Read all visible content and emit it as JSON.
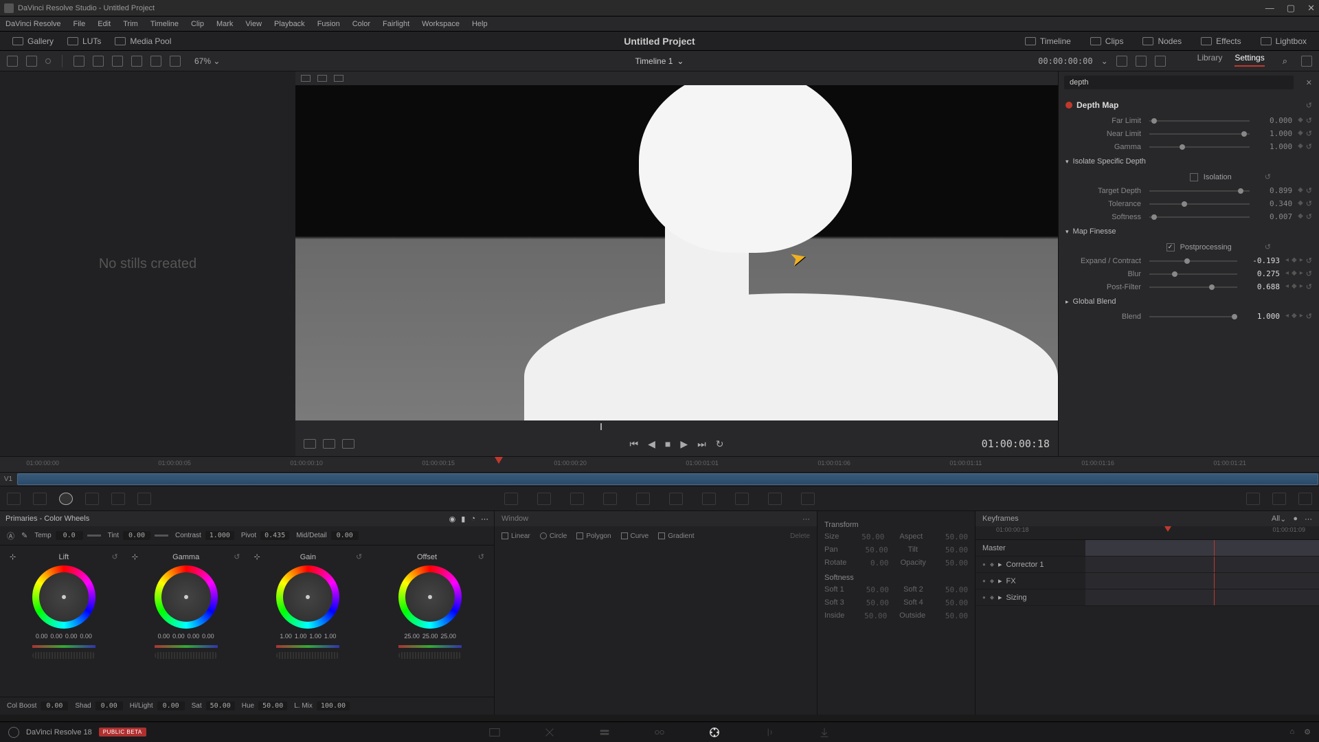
{
  "titlebar": {
    "text": "DaVinci Resolve Studio - Untitled Project"
  },
  "menu": [
    "DaVinci Resolve",
    "File",
    "Edit",
    "Trim",
    "Timeline",
    "Clip",
    "Mark",
    "View",
    "Playback",
    "Fusion",
    "Color",
    "Fairlight",
    "Workspace",
    "Help"
  ],
  "top_toolbar": {
    "left": [
      {
        "label": "Gallery",
        "icon": "gallery-icon"
      },
      {
        "label": "LUTs",
        "icon": "luts-icon"
      },
      {
        "label": "Media Pool",
        "icon": "mediapool-icon"
      }
    ],
    "project": "Untitled Project",
    "right": [
      {
        "label": "Timeline",
        "icon": "timeline-icon"
      },
      {
        "label": "Clips",
        "icon": "clips-icon"
      },
      {
        "label": "Nodes",
        "icon": "nodes-icon"
      },
      {
        "label": "Effects",
        "icon": "effects-icon"
      },
      {
        "label": "Lightbox",
        "icon": "lightbox-icon"
      }
    ]
  },
  "secondary": {
    "zoom": "67%",
    "timeline_name": "Timeline 1",
    "timecode": "00:00:00:00",
    "tabs": {
      "library": "Library",
      "settings": "Settings"
    }
  },
  "gallery_empty": "No stills created",
  "transport_tc": "01:00:00:18",
  "inspector": {
    "search": "depth",
    "effect": "Depth Map",
    "params": {
      "far_limit": {
        "label": "Far Limit",
        "value": "0.000"
      },
      "near_limit": {
        "label": "Near Limit",
        "value": "1.000"
      },
      "gamma": {
        "label": "Gamma",
        "value": "1.000"
      }
    },
    "isolate": {
      "header": "Isolate Specific Depth",
      "isolation_label": "Isolation",
      "target_depth": {
        "label": "Target Depth",
        "value": "0.899"
      },
      "tolerance": {
        "label": "Tolerance",
        "value": "0.340"
      },
      "softness": {
        "label": "Softness",
        "value": "0.007"
      }
    },
    "finesse": {
      "header": "Map Finesse",
      "postprocessing_label": "Postprocessing",
      "postprocessing_checked": true,
      "expand": {
        "label": "Expand / Contract",
        "value": "-0.193"
      },
      "blur": {
        "label": "Blur",
        "value": "0.275"
      },
      "postfilter": {
        "label": "Post-Filter",
        "value": "0.688"
      }
    },
    "global_blend": {
      "header": "Global Blend",
      "blend": {
        "label": "Blend",
        "value": "1.000"
      }
    }
  },
  "ruler_ticks": [
    "01:00:00:00",
    "01:00:00:05",
    "01:00:00:10",
    "01:00:00:15",
    "01:00:00:20",
    "01:00:01:01",
    "01:00:01:06",
    "01:00:01:11",
    "01:00:01:16",
    "01:00:01:21"
  ],
  "track_label": "V1",
  "primaries": {
    "title": "Primaries - Color Wheels",
    "adjust": {
      "temp": {
        "label": "Temp",
        "value": "0.0"
      },
      "tint": {
        "label": "Tint",
        "value": "0.00"
      },
      "contrast": {
        "label": "Contrast",
        "value": "1.000"
      },
      "pivot": {
        "label": "Pivot",
        "value": "0.435"
      },
      "middetail": {
        "label": "Mid/Detail",
        "value": "0.00"
      }
    },
    "wheels": [
      {
        "name": "Lift",
        "vals": [
          "0.00",
          "0.00",
          "0.00",
          "0.00"
        ]
      },
      {
        "name": "Gamma",
        "vals": [
          "0.00",
          "0.00",
          "0.00",
          "0.00"
        ]
      },
      {
        "name": "Gain",
        "vals": [
          "1.00",
          "1.00",
          "1.00",
          "1.00"
        ]
      },
      {
        "name": "Offset",
        "vals": [
          "25.00",
          "25.00",
          "25.00"
        ]
      }
    ],
    "footer": {
      "colboost": {
        "label": "Col Boost",
        "value": "0.00"
      },
      "shad": {
        "label": "Shad",
        "value": "0.00"
      },
      "hilight": {
        "label": "Hi/Light",
        "value": "0.00"
      },
      "sat": {
        "label": "Sat",
        "value": "50.00"
      },
      "hue": {
        "label": "Hue",
        "value": "50.00"
      },
      "lmix": {
        "label": "L. Mix",
        "value": "100.00"
      }
    }
  },
  "window_panel": {
    "title": "Window",
    "tools": [
      "Linear",
      "Circle",
      "Polygon",
      "Curve",
      "Gradient"
    ],
    "delete": "Delete"
  },
  "transform": {
    "title": "Transform",
    "size": {
      "label": "Size",
      "value": "50.00"
    },
    "aspect": {
      "label": "Aspect",
      "value": "50.00"
    },
    "pan": {
      "label": "Pan",
      "value": "50.00"
    },
    "tilt": {
      "label": "Tilt",
      "value": "50.00"
    },
    "rotate": {
      "label": "Rotate",
      "value": "0.00"
    },
    "opacity": {
      "label": "Opacity",
      "value": "50.00"
    },
    "softness_header": "Softness",
    "soft1": {
      "label": "Soft 1",
      "value": "50.00"
    },
    "soft2": {
      "label": "Soft 2",
      "value": "50.00"
    },
    "soft3": {
      "label": "Soft 3",
      "value": "50.00"
    },
    "soft4": {
      "label": "Soft 4",
      "value": "50.00"
    },
    "inside": {
      "label": "Inside",
      "value": "50.00"
    },
    "outside": {
      "label": "Outside",
      "value": "50.00"
    }
  },
  "keyframes": {
    "title": "Keyframes",
    "filter": "All",
    "ruler": [
      "01:00:00:18",
      "01:00:01:09"
    ],
    "rows": [
      "Master",
      "Corrector 1",
      "FX",
      "Sizing"
    ]
  },
  "pages_bar": {
    "app": "DaVinci Resolve 18",
    "badge": "PUBLIC BETA"
  }
}
